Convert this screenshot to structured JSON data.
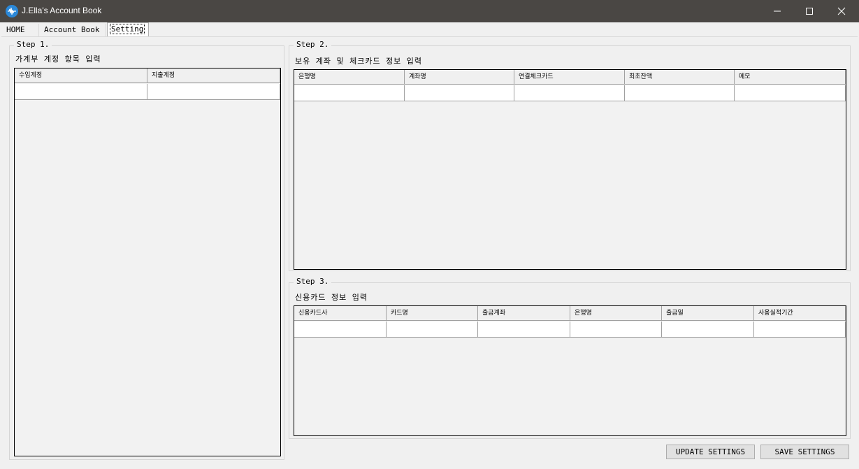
{
  "window": {
    "title": "J.Ella's Account Book",
    "app_icon": "waveform-icon",
    "controls": [
      "minimize-icon",
      "maximize-icon",
      "close-icon"
    ]
  },
  "tabs": [
    {
      "label": "HOME",
      "selected": false
    },
    {
      "label": "Account Book",
      "selected": false
    },
    {
      "label": "Setting",
      "selected": true
    }
  ],
  "step1": {
    "legend": "Step 1.",
    "description": "가계부 계정 항목 입력",
    "columns": [
      "수입계정",
      "지출계정"
    ]
  },
  "step2": {
    "legend": "Step 2.",
    "description": "보유 계좌 및 체크카드 정보 입력",
    "columns": [
      "은행명",
      "계좌명",
      "연결체크카드",
      "최초잔액",
      "메모"
    ]
  },
  "step3": {
    "legend": "Step 3.",
    "description": "신용카드 정보 입력",
    "columns": [
      "신용카드사",
      "카드명",
      "출금계좌",
      "은행명",
      "출금일",
      "사용실적기간"
    ]
  },
  "buttons": {
    "update": "UPDATE SETTINGS",
    "save": "SAVE SETTINGS"
  },
  "colors": {
    "titlebar": "#4a4744",
    "app_icon": "#2b88d8"
  }
}
